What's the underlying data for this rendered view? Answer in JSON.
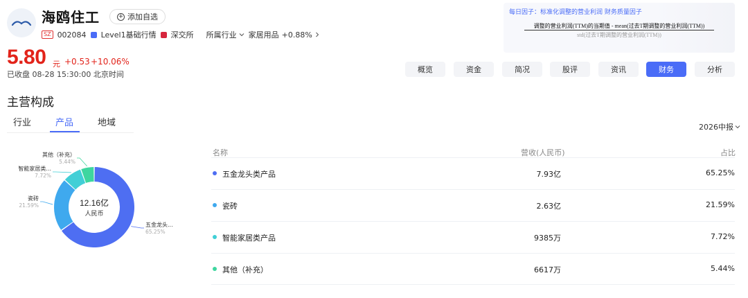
{
  "stock": {
    "name": "海鸥住工",
    "add_watch_label": "添加自选",
    "market_badge": "SZ",
    "code": "002084",
    "level1_label": "Level1基础行情",
    "exchange_label": "深交所",
    "industry_prefix": "所属行业",
    "industry": "家居用品",
    "industry_change": "+0.88%",
    "price": "5.80",
    "price_unit": "元",
    "change": "+0.53",
    "change_pct": "+10.06%",
    "status": "已收盘 08-28 15:30:00 北京时间"
  },
  "factor": {
    "title": "每日因子：标准化调整的营业利润 财务质量因子",
    "numerator": "调整的营业利润(TTM)的当期值 - mean(过去T期调整的营业利润(TTM))",
    "denominator": "std(过去T期调整的营业利润(TTM))"
  },
  "nav": [
    "概览",
    "资金",
    "简况",
    "股评",
    "资讯",
    "财务",
    "分析"
  ],
  "nav_active_index": 5,
  "section": {
    "title": "主营构成",
    "tabs": [
      "行业",
      "产品",
      "地域"
    ],
    "active_tab_index": 1,
    "period": "2026中报"
  },
  "table": {
    "headers": [
      "名称",
      "营收(人民币)",
      "占比"
    ],
    "rows": [
      {
        "name": "五金龙头类产品",
        "revenue": "7.93亿",
        "share": "65.25%",
        "color": "#4e6ef2"
      },
      {
        "name": "瓷砖",
        "revenue": "2.63亿",
        "share": "21.59%",
        "color": "#3fa9ee"
      },
      {
        "name": "智能家居类产品",
        "revenue": "9385万",
        "share": "7.72%",
        "color": "#41cfd6"
      },
      {
        "name": "其他（补充）",
        "revenue": "6617万",
        "share": "5.44%",
        "color": "#3ed69f"
      }
    ]
  },
  "chart_data": {
    "type": "pie",
    "center_value": "12.16亿",
    "center_unit": "人民币",
    "slices": [
      {
        "label": "五金龙头...",
        "value": 65.25,
        "pct_label": "65.25%",
        "color": "#4e6ef2"
      },
      {
        "label": "瓷砖",
        "value": 21.59,
        "pct_label": "21.59%",
        "color": "#3fa9ee"
      },
      {
        "label": "智能家居类...",
        "value": 7.72,
        "pct_label": "7.72%",
        "color": "#41cfd6"
      },
      {
        "label": "其他（补充）",
        "value": 5.44,
        "pct_label": "5.44%",
        "color": "#3ed69f"
      }
    ]
  }
}
